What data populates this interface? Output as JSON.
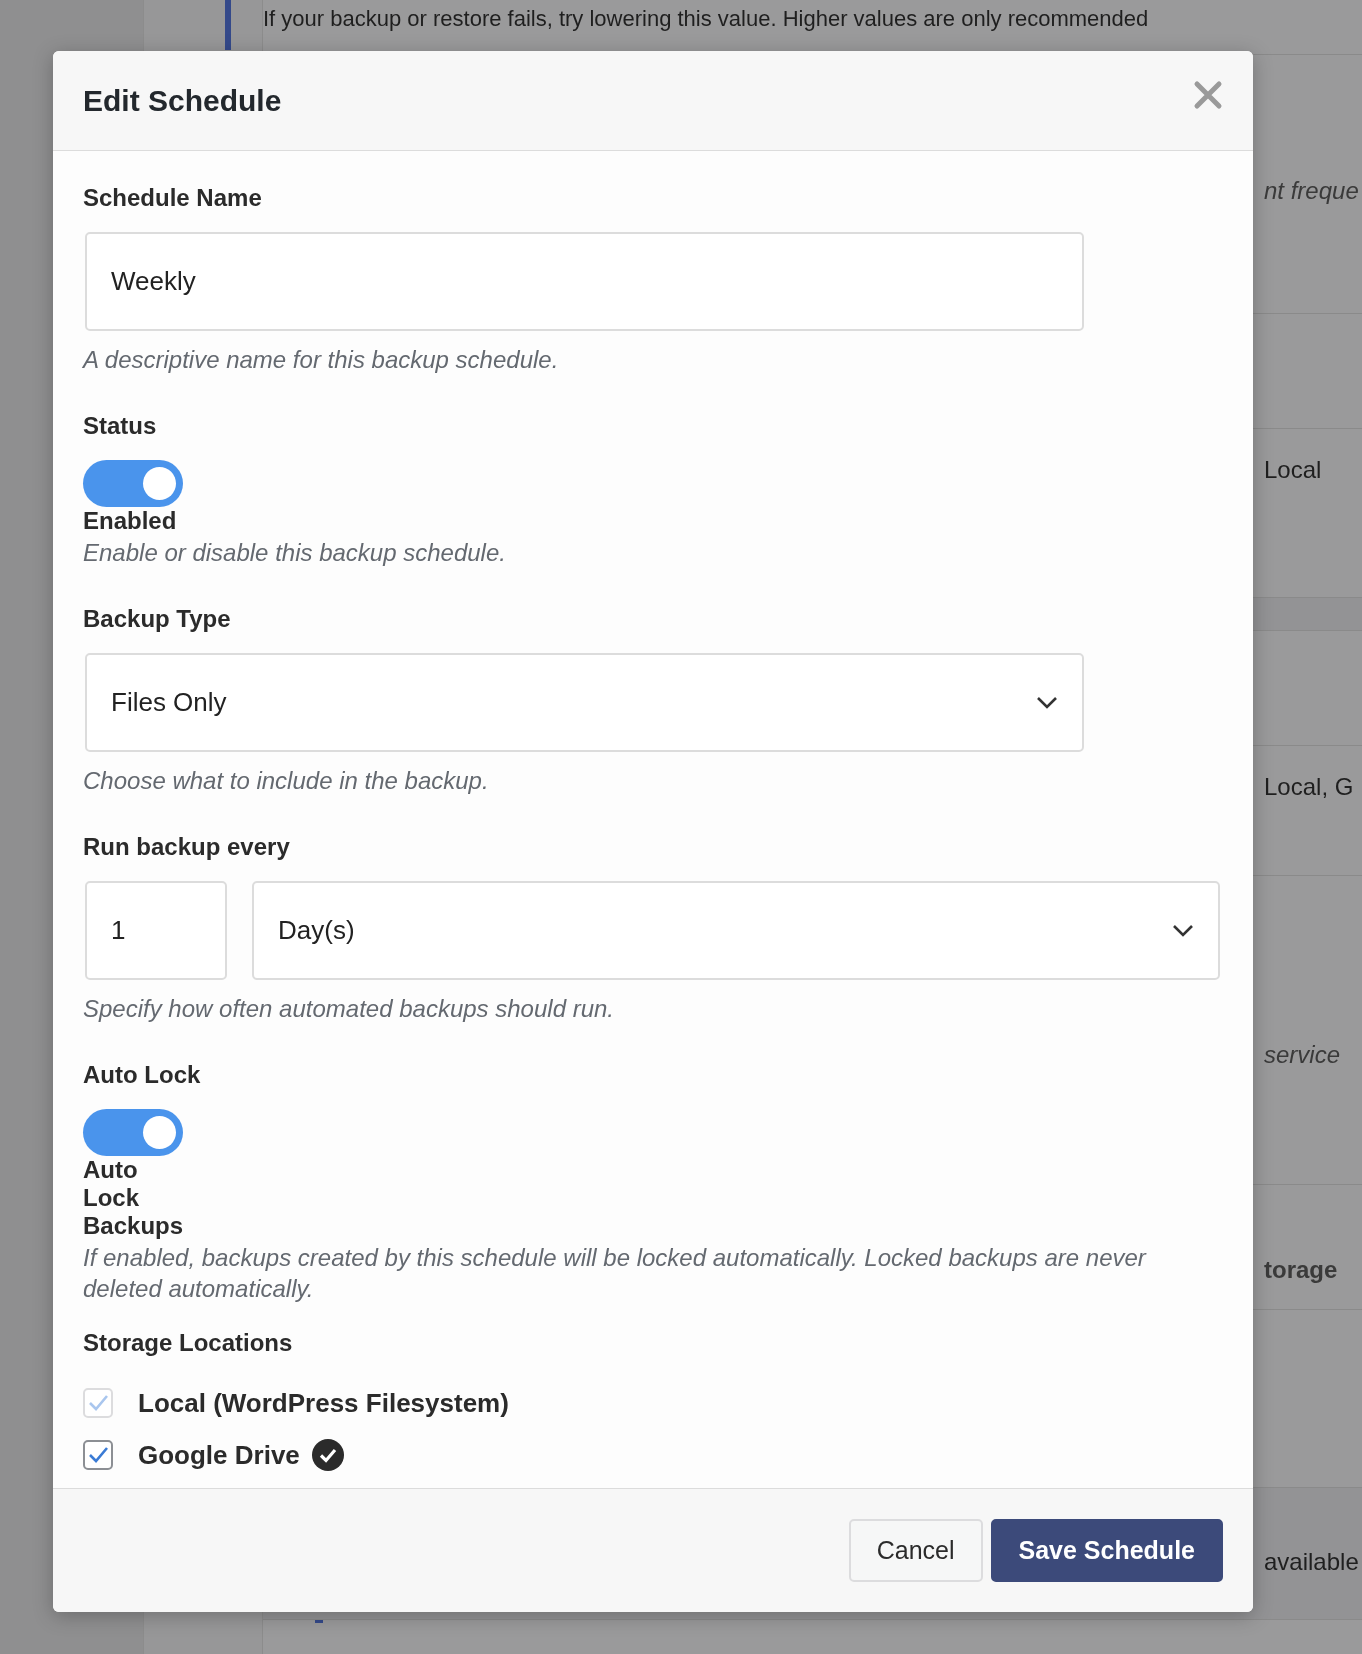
{
  "background": {
    "notice": "If your backup or restore fails, try lowering this value. Higher values are only recommended",
    "fragments": [
      {
        "text": "nt freque",
        "kind": "note"
      },
      {
        "text": "Local",
        "kind": "value"
      },
      {
        "text": "Local, G",
        "kind": "value"
      },
      {
        "text": "service",
        "kind": "note"
      },
      {
        "text": "torage",
        "kind": "heading"
      },
      {
        "text": "available",
        "kind": "value"
      }
    ]
  },
  "dialog": {
    "title": "Edit Schedule",
    "fields": [
      {
        "kind": "text",
        "label": "Schedule Name",
        "value": "Weekly",
        "help": "A descriptive name for this backup schedule."
      },
      {
        "kind": "toggle",
        "label": "Status",
        "on": true,
        "toggle_label": "Enabled",
        "help": "Enable or disable this backup schedule."
      },
      {
        "kind": "select",
        "label": "Backup Type",
        "value": "Files Only",
        "help": "Choose what to include in the backup."
      },
      {
        "kind": "interval",
        "label": "Run backup every",
        "number": "1",
        "unit": "Day(s)",
        "help": "Specify how often automated backups should run."
      },
      {
        "kind": "toggle",
        "label": "Auto Lock",
        "on": true,
        "toggle_label": "Auto Lock Backups",
        "help": "If enabled, backups created by this schedule will be locked automatically. Locked backups are never deleted automatically."
      },
      {
        "kind": "checkboxes",
        "label": "Storage Locations",
        "options": [
          {
            "label": "Local (WordPress Filesystem)",
            "checked": true,
            "disabled": true,
            "verified": false
          },
          {
            "label": "Google Drive",
            "checked": true,
            "disabled": false,
            "verified": true
          }
        ]
      }
    ],
    "buttons": [
      {
        "label": "Cancel",
        "kind": "secondary"
      },
      {
        "label": "Save Schedule",
        "kind": "primary"
      }
    ]
  }
}
